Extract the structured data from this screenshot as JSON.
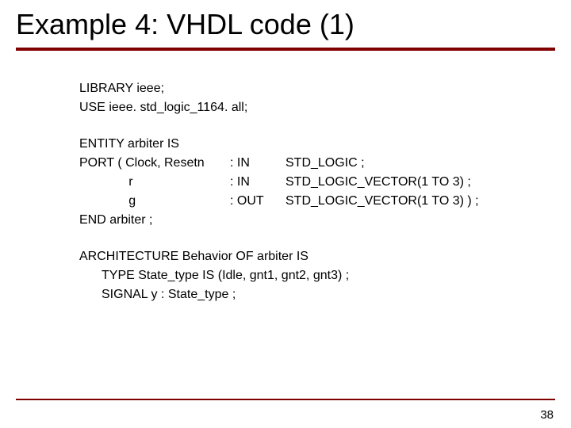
{
  "title": "Example 4: VHDL code (1)",
  "code": {
    "l1": "LIBRARY ieee;",
    "l2": "USE ieee. std_logic_1164. all;",
    "l3": "ENTITY arbiter IS",
    "port_row1": {
      "c1": "PORT ( Clock, Resetn",
      "c2": ": IN",
      "c3": "STD_LOGIC ;"
    },
    "port_row2": {
      "c1": "              r",
      "c2": ": IN",
      "c3": "STD_LOGIC_VECTOR(1 TO 3) ;"
    },
    "port_row3": {
      "c1": "              g",
      "c2": ": OUT",
      "c3": "STD_LOGIC_VECTOR(1 TO 3) ) ;"
    },
    "l4": "END arbiter ;",
    "l5": "ARCHITECTURE Behavior OF arbiter IS",
    "l6": "TYPE State_type IS (Idle, gnt1, gnt2, gnt3) ;",
    "l7": "SIGNAL y : State_type ;"
  },
  "page_number": "38"
}
